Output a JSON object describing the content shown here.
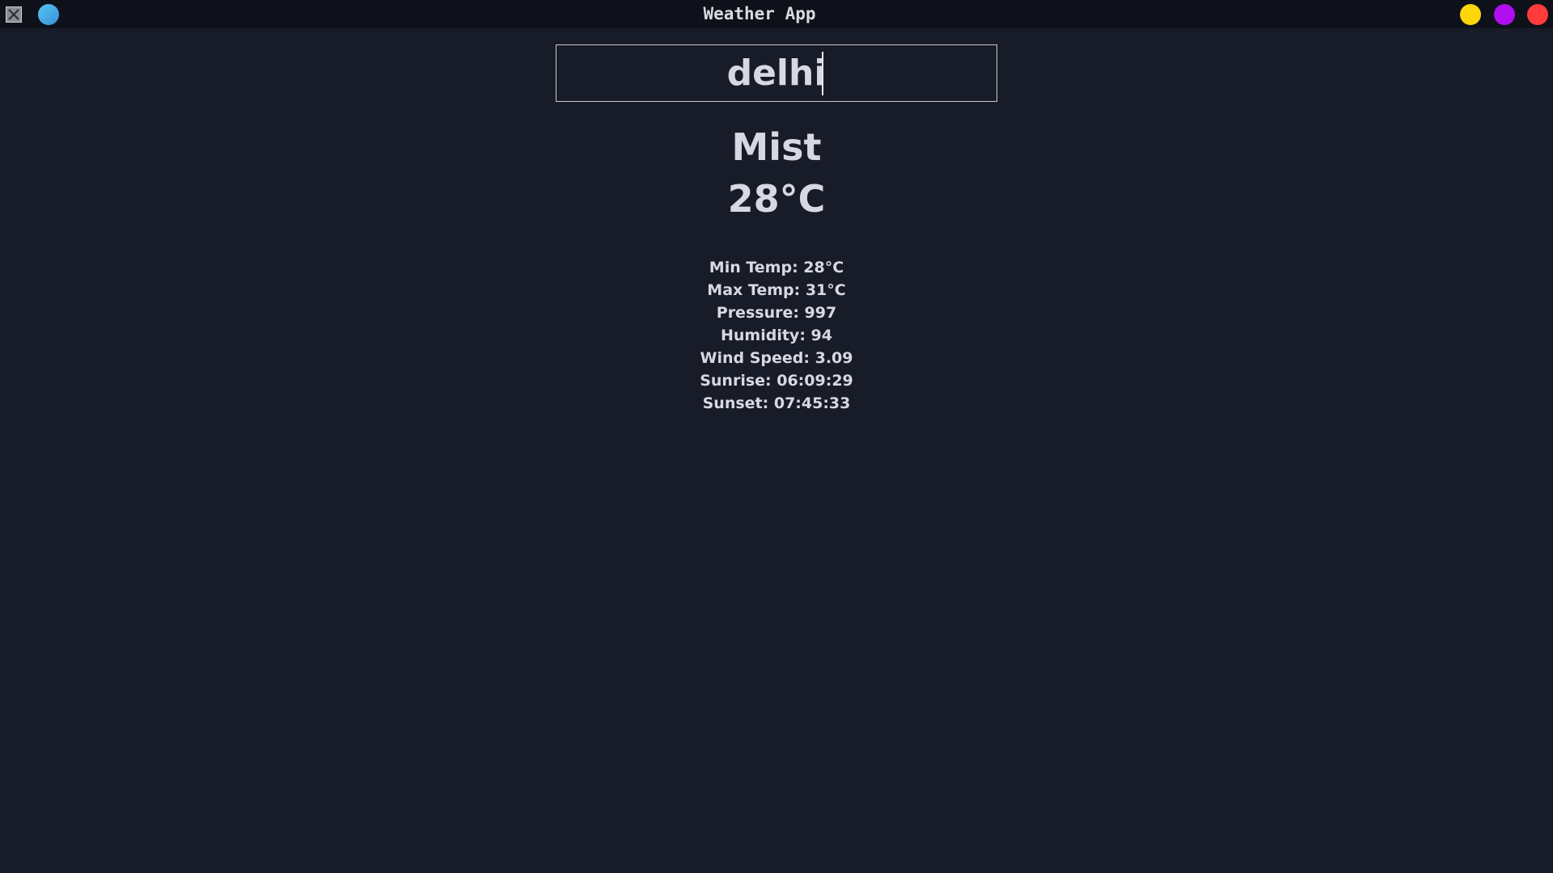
{
  "window": {
    "title": "Weather App",
    "controls": [
      {
        "name": "minimize",
        "color": "#ffd60a"
      },
      {
        "name": "maximize",
        "color": "#b10df0"
      },
      {
        "name": "close",
        "color": "#ff3b3b"
      }
    ],
    "app_indicator_color": "#4aa8e6"
  },
  "search": {
    "value": "delhi"
  },
  "weather": {
    "condition": "Mist",
    "temperature": "28°C",
    "details": {
      "min_temp": "Min Temp: 28°C",
      "max_temp": "Max Temp: 31°C",
      "pressure": "Pressure: 997",
      "humidity": "Humidity: 94",
      "wind_speed": "Wind Speed: 3.09",
      "sunrise": "Sunrise: 06:09:29",
      "sunset": "Sunset: 07:45:33"
    }
  },
  "colors": {
    "background": "#181c28",
    "titlebar": "#0e111a",
    "text": "#d6d9e2"
  }
}
